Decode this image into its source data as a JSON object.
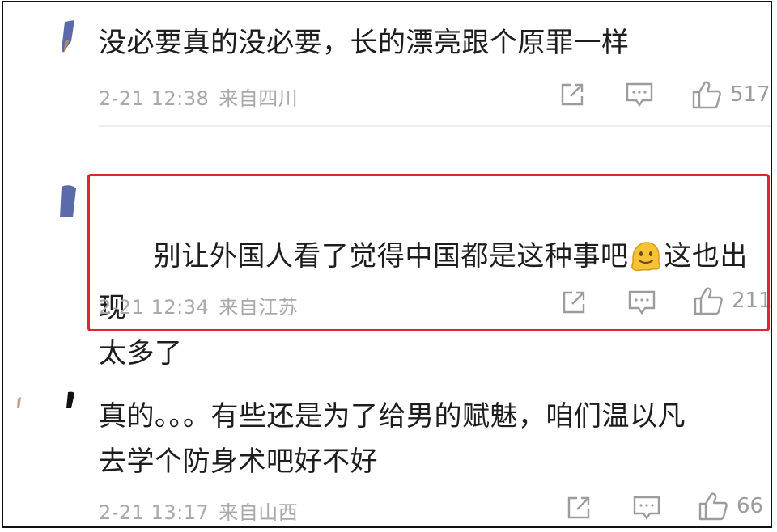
{
  "comments": [
    {
      "text": "没必要真的没必要，长的漂亮跟个原罪一样",
      "date": "2-21 12:38",
      "location": "来自四川",
      "likes": "517"
    },
    {
      "text_before_emoji": "别让外国人看了觉得中国都是这种事吧",
      "text_after_emoji": "这也出现\n太多了",
      "emoji": "melting-face-emoji",
      "date": "2-21 12:34",
      "location": "来自江苏",
      "likes": "211",
      "highlighted": true
    },
    {
      "text": "真的。。。有些还是为了给男的赋魅，咱们温以凡\n去学个防身术吧好不好",
      "date": "2-21 13:17",
      "location": "来自山西",
      "likes": "66"
    }
  ],
  "colors": {
    "text": "#1d1d1d",
    "meta": "#a9a9a9",
    "icon": "#9c9c9c",
    "highlight_border": "#e0252b",
    "divider": "#ececec"
  },
  "icons": [
    "share-icon",
    "comment-icon",
    "like-icon"
  ]
}
